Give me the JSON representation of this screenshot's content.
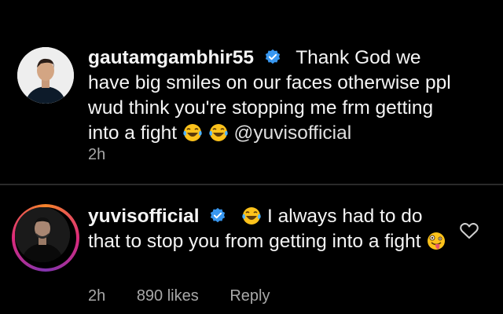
{
  "comments": [
    {
      "username": "gautamgambhir55",
      "verified": true,
      "text_parts": [
        "Thank God we have big smiles on our faces otherwise ppl wud think you're stopping me frm getting into a fight",
        "@yuvisofficial"
      ],
      "emojis": [
        "face-with-tears-of-joy",
        "face-with-tears-of-joy"
      ],
      "time": "2h"
    },
    {
      "username": "yuvisofficial",
      "verified": true,
      "leading_emoji": "face-with-tears-of-joy",
      "text": "I always had to do that to stop you from getting into a fight",
      "trailing_emoji": "zany-face",
      "time": "2h",
      "likes": "890 likes",
      "reply_label": "Reply",
      "like_icon": "heart-outline-icon",
      "has_story_ring": true
    }
  ],
  "colors": {
    "background": "#000000",
    "text": "#f5f5f5",
    "meta": "#a8a8a8",
    "verified": "#3897f0"
  }
}
